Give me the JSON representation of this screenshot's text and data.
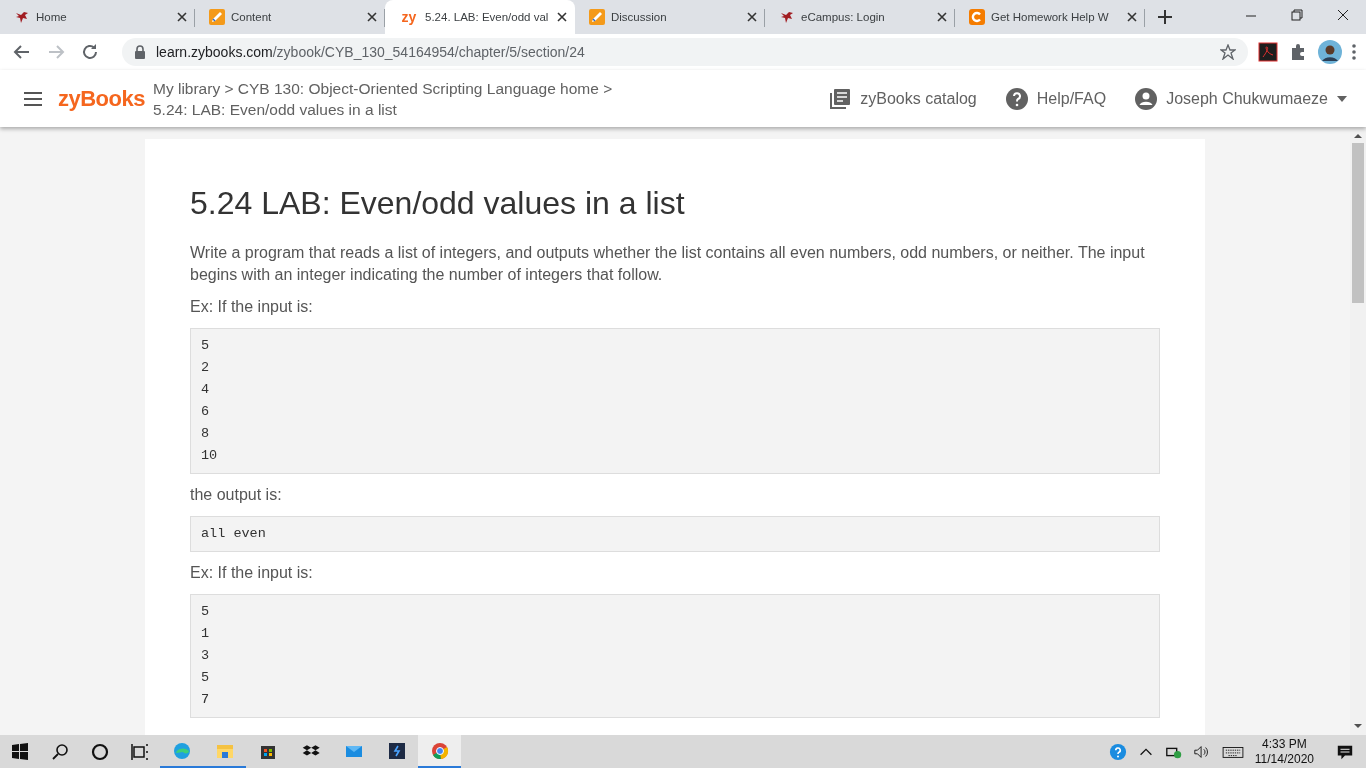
{
  "browser": {
    "tabs": [
      {
        "title": "Home",
        "kind": "bird",
        "selected": false
      },
      {
        "title": "Content",
        "kind": "pencil",
        "selected": false
      },
      {
        "title": "5.24. LAB: Even/odd val",
        "kind": "zy",
        "logo_text": "zy",
        "selected": true
      },
      {
        "title": "Discussion",
        "kind": "pencil",
        "selected": false
      },
      {
        "title": "eCampus: Login",
        "kind": "bird",
        "selected": false
      },
      {
        "title": "Get Homework Help W",
        "kind": "c",
        "selected": false
      }
    ],
    "url_host": "learn.zybooks.com",
    "url_path": "/zybook/CYB_130_54164954/chapter/5/section/24"
  },
  "header": {
    "logo": "zyBooks",
    "breadcrumb_line_1": "My library > CYB 130: Object-Oriented Scripting Language home >",
    "breadcrumb_line_2": "5.24: LAB: Even/odd values in a list",
    "catalog": "zyBooks catalog",
    "help": "Help/FAQ",
    "user": "Joseph Chukwumaeze"
  },
  "content": {
    "title": "5.24 LAB: Even/odd values in a list",
    "blocks": [
      {
        "kind": "text",
        "text": "Write a program that reads a list of integers, and outputs whether the list contains all even numbers, odd numbers, or neither. The input begins with an integer indicating the number of integers that follow."
      },
      {
        "kind": "text",
        "text": "Ex: If the input is:"
      },
      {
        "kind": "code",
        "lines": [
          "5",
          "2",
          "4",
          "6",
          "8",
          "10"
        ]
      },
      {
        "kind": "text",
        "text": "the output is:"
      },
      {
        "kind": "code",
        "lines": [
          "all even"
        ]
      },
      {
        "kind": "text",
        "text": "Ex: If the input is:"
      },
      {
        "kind": "code",
        "lines": [
          "5",
          "1",
          "3",
          "5",
          "7"
        ]
      }
    ]
  },
  "taskbar": {
    "apps": [
      {
        "kind": "edge",
        "running": true,
        "selected": false
      },
      {
        "kind": "explorer",
        "running": true,
        "selected": false
      },
      {
        "kind": "store",
        "running": false,
        "selected": false
      },
      {
        "kind": "dropbox",
        "running": false,
        "selected": false
      },
      {
        "kind": "mail",
        "running": false,
        "selected": false
      },
      {
        "kind": "terminal",
        "running": false,
        "selected": false
      },
      {
        "kind": "chrome",
        "running": true,
        "selected": true
      }
    ],
    "time": "4:33 PM",
    "date": "11/14/2020"
  }
}
